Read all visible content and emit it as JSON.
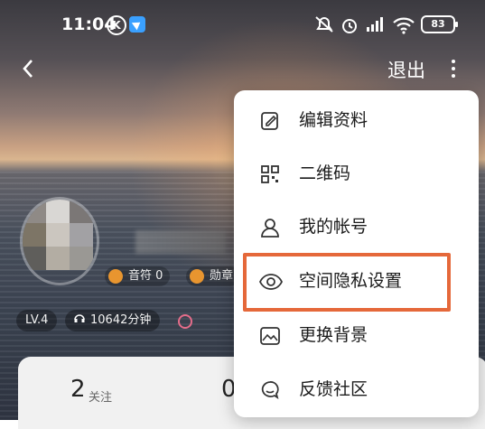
{
  "status_bar": {
    "time": "11:04",
    "k_icon": "K",
    "battery": "83",
    "icons": [
      "app-badge-icon",
      "mute-icon",
      "alarm-icon",
      "signal-icon",
      "wifi-icon",
      "battery-icon"
    ]
  },
  "top_bar": {
    "back_icon": "chevron-left-icon",
    "logout_label": "退出",
    "more_icon": "more-vertical-icon"
  },
  "profile": {
    "badges": [
      {
        "label": "音符 0",
        "icon": "medal-icon"
      },
      {
        "label": "勋章",
        "icon": "star-medal-icon"
      }
    ],
    "level": "LV.4",
    "listen_time": "10642分钟",
    "stats": [
      {
        "value": "2",
        "label": "关注"
      },
      {
        "value": "0",
        "label": ""
      }
    ]
  },
  "menu": {
    "items": [
      {
        "label": "编辑资料",
        "icon": "edit-icon"
      },
      {
        "label": "二维码",
        "icon": "qrcode-icon"
      },
      {
        "label": "我的帐号",
        "icon": "user-icon"
      },
      {
        "label": "空间隐私设置",
        "icon": "eye-icon"
      },
      {
        "label": "更换背景",
        "icon": "image-icon"
      },
      {
        "label": "反馈社区",
        "icon": "feedback-icon"
      }
    ],
    "highlighted_index": 3
  },
  "colors": {
    "highlight_border": "#e5683a",
    "menu_bg": "#ffffff"
  }
}
